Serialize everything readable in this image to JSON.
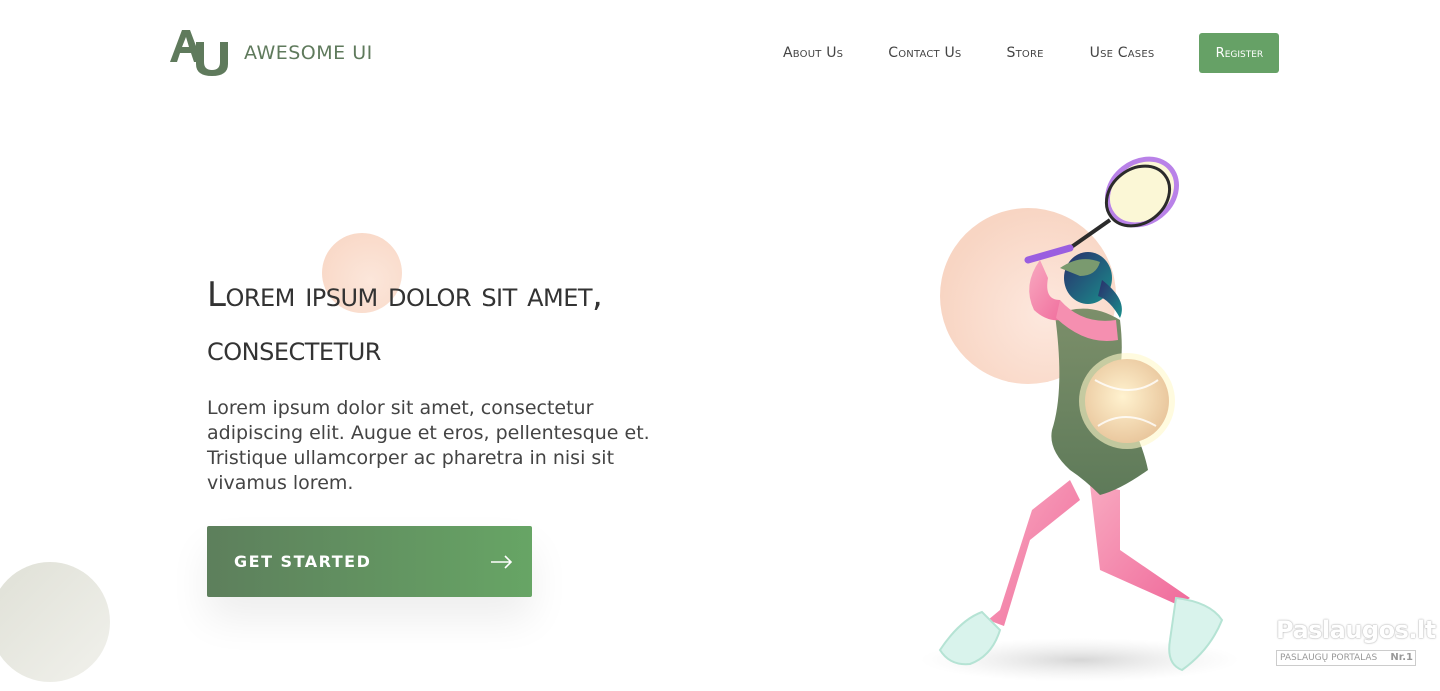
{
  "header": {
    "logo_text": "AWESOME UI",
    "nav": [
      {
        "label": "About Us"
      },
      {
        "label": "Contact Us"
      },
      {
        "label": "Store"
      },
      {
        "label": "Use Cases"
      }
    ],
    "register_label": "Register"
  },
  "hero": {
    "title": "Lorem ipsum dolor sit amet, consectetur",
    "text": "Lorem ipsum dolor sit amet, consectetur adipiscing elit. Augue et eros, pellentesque et. Tristique ullamcorper ac pharetra in nisi sit vivamus lorem.",
    "cta_label": "GET STARTED",
    "cta_icon": "arrow-right-icon"
  },
  "watermark": {
    "main": "Paslaugos.lt",
    "sub": "PASLAUGŲ PORTALAS",
    "rank": "Nr.1"
  },
  "colors": {
    "brand_green": "#5f7a5c",
    "button_green": "#66a166",
    "peach": "#f7cdb7"
  }
}
